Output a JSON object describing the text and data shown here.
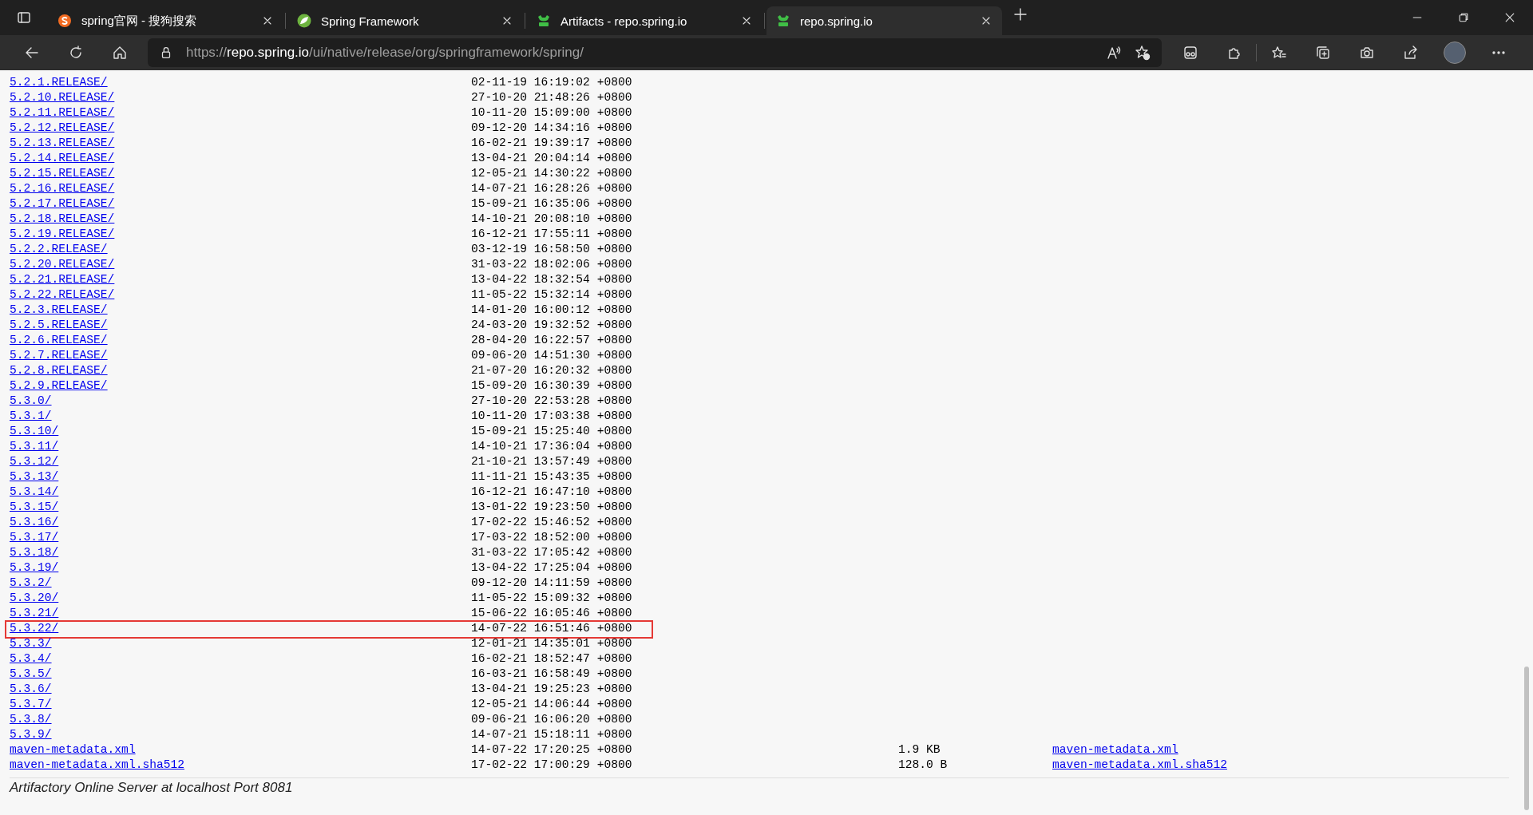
{
  "tabs": [
    {
      "title": "spring官网 - 搜狗搜索",
      "kind": "sogou",
      "selected": false
    },
    {
      "title": "Spring Framework",
      "kind": "spring",
      "selected": false
    },
    {
      "title": "Artifacts - repo.spring.io",
      "kind": "jfrog",
      "selected": false
    },
    {
      "title": "repo.spring.io",
      "kind": "jfrog",
      "selected": true
    }
  ],
  "address_bar": {
    "scheme": "https://",
    "host": "repo.spring.io",
    "path": "/ui/native/release/org/springframework/spring/"
  },
  "rows": [
    {
      "name": "5.2.1.RELEASE/",
      "modified": "02-11-19 16:19:02 +0800",
      "highlighted": false
    },
    {
      "name": "5.2.10.RELEASE/",
      "modified": "27-10-20 21:48:26 +0800",
      "highlighted": false
    },
    {
      "name": "5.2.11.RELEASE/",
      "modified": "10-11-20 15:09:00 +0800",
      "highlighted": false
    },
    {
      "name": "5.2.12.RELEASE/",
      "modified": "09-12-20 14:34:16 +0800",
      "highlighted": false
    },
    {
      "name": "5.2.13.RELEASE/",
      "modified": "16-02-21 19:39:17 +0800",
      "highlighted": false
    },
    {
      "name": "5.2.14.RELEASE/",
      "modified": "13-04-21 20:04:14 +0800",
      "highlighted": false
    },
    {
      "name": "5.2.15.RELEASE/",
      "modified": "12-05-21 14:30:22 +0800",
      "highlighted": false
    },
    {
      "name": "5.2.16.RELEASE/",
      "modified": "14-07-21 16:28:26 +0800",
      "highlighted": false
    },
    {
      "name": "5.2.17.RELEASE/",
      "modified": "15-09-21 16:35:06 +0800",
      "highlighted": false
    },
    {
      "name": "5.2.18.RELEASE/",
      "modified": "14-10-21 20:08:10 +0800",
      "highlighted": false
    },
    {
      "name": "5.2.19.RELEASE/",
      "modified": "16-12-21 17:55:11 +0800",
      "highlighted": false
    },
    {
      "name": "5.2.2.RELEASE/",
      "modified": "03-12-19 16:58:50 +0800",
      "highlighted": false
    },
    {
      "name": "5.2.20.RELEASE/",
      "modified": "31-03-22 18:02:06 +0800",
      "highlighted": false
    },
    {
      "name": "5.2.21.RELEASE/",
      "modified": "13-04-22 18:32:54 +0800",
      "highlighted": false
    },
    {
      "name": "5.2.22.RELEASE/",
      "modified": "11-05-22 15:32:14 +0800",
      "highlighted": false
    },
    {
      "name": "5.2.3.RELEASE/",
      "modified": "14-01-20 16:00:12 +0800",
      "highlighted": false
    },
    {
      "name": "5.2.5.RELEASE/",
      "modified": "24-03-20 19:32:52 +0800",
      "highlighted": false
    },
    {
      "name": "5.2.6.RELEASE/",
      "modified": "28-04-20 16:22:57 +0800",
      "highlighted": false
    },
    {
      "name": "5.2.7.RELEASE/",
      "modified": "09-06-20 14:51:30 +0800",
      "highlighted": false
    },
    {
      "name": "5.2.8.RELEASE/",
      "modified": "21-07-20 16:20:32 +0800",
      "highlighted": false
    },
    {
      "name": "5.2.9.RELEASE/",
      "modified": "15-09-20 16:30:39 +0800",
      "highlighted": false
    },
    {
      "name": "5.3.0/",
      "modified": "27-10-20 22:53:28 +0800",
      "highlighted": false
    },
    {
      "name": "5.3.1/",
      "modified": "10-11-20 17:03:38 +0800",
      "highlighted": false
    },
    {
      "name": "5.3.10/",
      "modified": "15-09-21 15:25:40 +0800",
      "highlighted": false
    },
    {
      "name": "5.3.11/",
      "modified": "14-10-21 17:36:04 +0800",
      "highlighted": false
    },
    {
      "name": "5.3.12/",
      "modified": "21-10-21 13:57:49 +0800",
      "highlighted": false
    },
    {
      "name": "5.3.13/",
      "modified": "11-11-21 15:43:35 +0800",
      "highlighted": false
    },
    {
      "name": "5.3.14/",
      "modified": "16-12-21 16:47:10 +0800",
      "highlighted": false
    },
    {
      "name": "5.3.15/",
      "modified": "13-01-22 19:23:50 +0800",
      "highlighted": false
    },
    {
      "name": "5.3.16/",
      "modified": "17-02-22 15:46:52 +0800",
      "highlighted": false
    },
    {
      "name": "5.3.17/",
      "modified": "17-03-22 18:52:00 +0800",
      "highlighted": false
    },
    {
      "name": "5.3.18/",
      "modified": "31-03-22 17:05:42 +0800",
      "highlighted": false
    },
    {
      "name": "5.3.19/",
      "modified": "13-04-22 17:25:04 +0800",
      "highlighted": false
    },
    {
      "name": "5.3.2/",
      "modified": "09-12-20 14:11:59 +0800",
      "highlighted": false
    },
    {
      "name": "5.3.20/",
      "modified": "11-05-22 15:09:32 +0800",
      "highlighted": false
    },
    {
      "name": "5.3.21/",
      "modified": "15-06-22 16:05:46 +0800",
      "highlighted": false
    },
    {
      "name": "5.3.22/",
      "modified": "14-07-22 16:51:46 +0800",
      "highlighted": true
    },
    {
      "name": "5.3.3/",
      "modified": "12-01-21 14:35:01 +0800",
      "highlighted": false
    },
    {
      "name": "5.3.4/",
      "modified": "16-02-21 18:52:47 +0800",
      "highlighted": false
    },
    {
      "name": "5.3.5/",
      "modified": "16-03-21 16:58:49 +0800",
      "highlighted": false
    },
    {
      "name": "5.3.6/",
      "modified": "13-04-21 19:25:23 +0800",
      "highlighted": false
    },
    {
      "name": "5.3.7/",
      "modified": "12-05-21 14:06:44 +0800",
      "highlighted": false
    },
    {
      "name": "5.3.8/",
      "modified": "09-06-21 16:06:20 +0800",
      "highlighted": false
    },
    {
      "name": "5.3.9/",
      "modified": "14-07-21 15:18:11 +0800",
      "highlighted": false
    },
    {
      "name": "maven-metadata.xml",
      "modified": "14-07-22 17:20:25 +0800",
      "size": "1.9 KB",
      "column_4": "maven-metadata.xml",
      "highlighted": false
    },
    {
      "name": "maven-metadata.xml.sha512",
      "modified": "17-02-22 17:00:29 +0800",
      "size": "128.0 B",
      "column_4": "maven-metadata.xml.sha512",
      "highlighted": false
    }
  ],
  "footer": "Artifactory Online Server at localhost Port 8081"
}
